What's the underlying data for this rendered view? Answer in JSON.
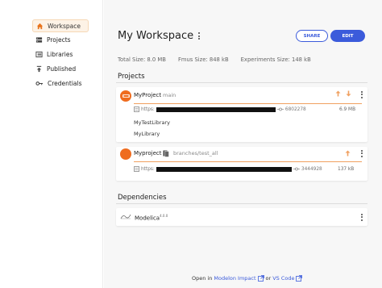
{
  "sidebar": {
    "items": [
      {
        "label": "Workspace",
        "icon": "home-icon",
        "active": true
      },
      {
        "label": "Projects",
        "icon": "projects-icon"
      },
      {
        "label": "Libraries",
        "icon": "libraries-icon"
      },
      {
        "label": "Published",
        "icon": "upload-icon"
      },
      {
        "label": "Credentials",
        "icon": "key-icon"
      }
    ]
  },
  "header": {
    "title": "My Workspace",
    "share_label": "SHARE",
    "edit_label": "EDIT"
  },
  "stats": {
    "total_size": "Total Size: 8.0 MB",
    "fmus_size": "Fmus Size: 848 kB",
    "experiments_size": "Experiments Size: 148 kB"
  },
  "projects": {
    "heading": "Projects",
    "items": [
      {
        "name": "MyProject",
        "branch": "main",
        "url_prefix": "https:",
        "commit": "6802278",
        "size": "6.9 MB",
        "libraries": [
          "MyTestLibrary",
          "MyLibrary"
        ]
      },
      {
        "name": "Myproject",
        "branch": "branches/test_all",
        "url_prefix": "https:",
        "commit": "3444928",
        "size": "137 kB"
      }
    ]
  },
  "dependencies": {
    "heading": "Dependencies",
    "items": [
      {
        "name": "Modelica",
        "version": "4.0.0"
      }
    ]
  },
  "footer": {
    "open_in": "Open in",
    "impact_link": "Modelon Impact",
    "or": "or",
    "vscode_link": "VS Code"
  },
  "colors": {
    "accent": "#3b5bdb",
    "brand_orange": "#ef6c1f",
    "active_bg": "#fdf2e6"
  }
}
